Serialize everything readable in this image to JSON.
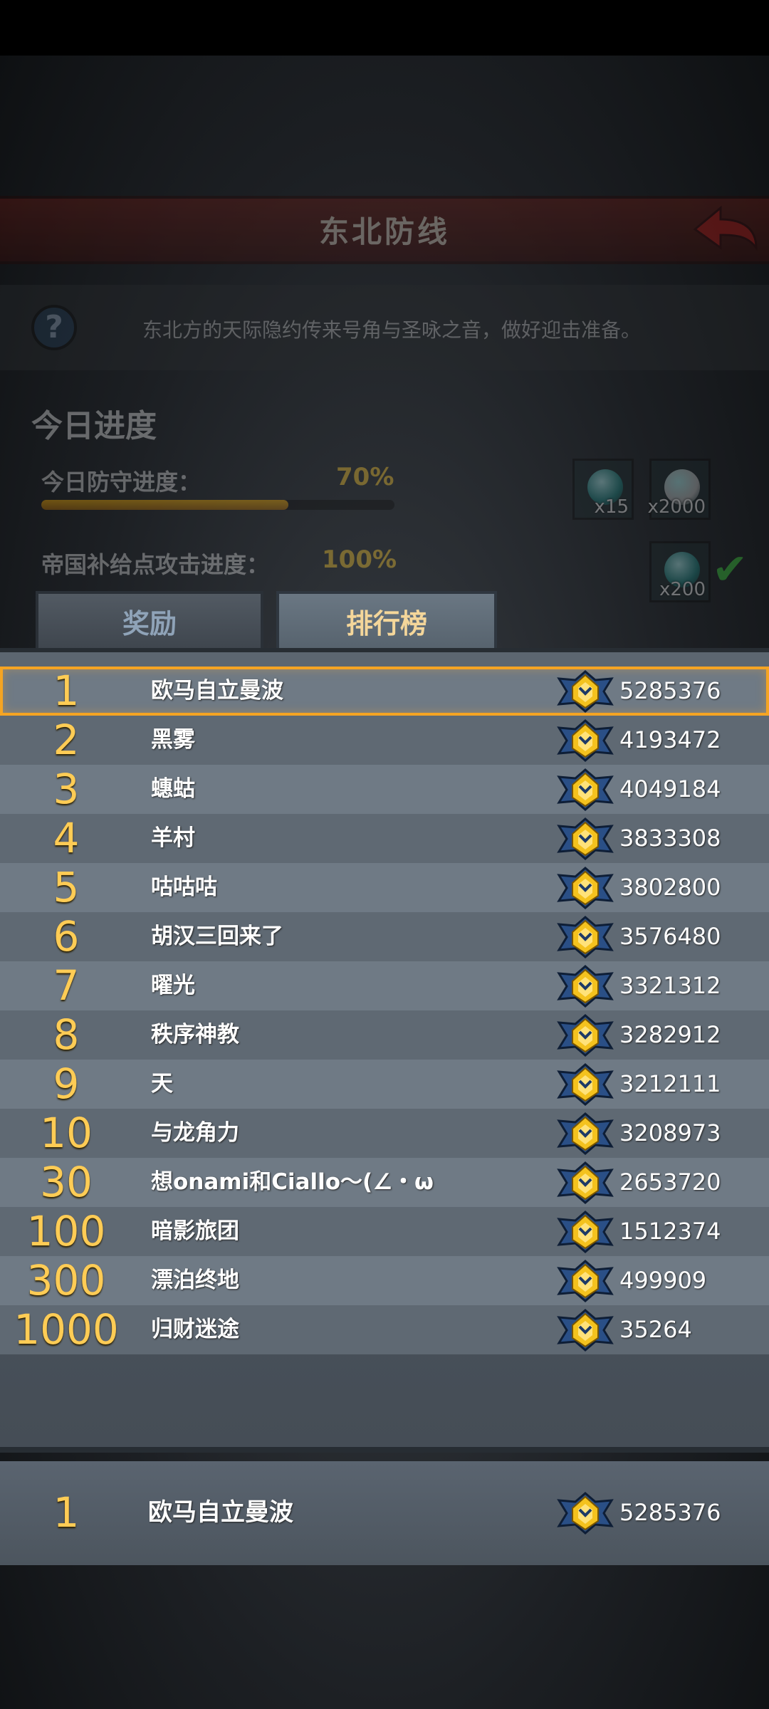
{
  "header": {
    "title": "东北防线"
  },
  "info": {
    "description": "东北方的天际隐约传来号角与圣咏之音，做好迎击准备。",
    "help_glyph": "?"
  },
  "progress": {
    "section_title": "今日进度",
    "items": [
      {
        "label": "今日防守进度：",
        "percent_text": "70%",
        "fraction": 0.7,
        "rewards": [
          {
            "count": "x15",
            "color": "#1e8a86"
          },
          {
            "count": "x2000",
            "color": "#c8c8c8"
          }
        ]
      },
      {
        "label": "帝国补给点攻击进度：",
        "percent_text": "100%",
        "fraction": 1.0,
        "rewards": [
          {
            "count": "x200",
            "color": "#1e8a86"
          }
        ],
        "completed": true
      }
    ]
  },
  "tabs": {
    "rewards": "奖励",
    "ranking": "排行榜",
    "active": "ranking"
  },
  "ranking": [
    {
      "rank": "1",
      "name": "欧马自立曼波",
      "score": "5285376"
    },
    {
      "rank": "2",
      "name": "黑雾",
      "score": "4193472"
    },
    {
      "rank": "3",
      "name": "蟪蛄",
      "score": "4049184"
    },
    {
      "rank": "4",
      "name": "羊村",
      "score": "3833308"
    },
    {
      "rank": "5",
      "name": "咕咕咕",
      "score": "3802800"
    },
    {
      "rank": "6",
      "name": "胡汉三回来了",
      "score": "3576480"
    },
    {
      "rank": "7",
      "name": "曜光",
      "score": "3321312"
    },
    {
      "rank": "8",
      "name": "秩序神教",
      "score": "3282912"
    },
    {
      "rank": "9",
      "name": "天",
      "score": "3212111"
    },
    {
      "rank": "10",
      "name": "与龙角力",
      "score": "3208973"
    },
    {
      "rank": "30",
      "name": "想onami和Ciallo～(∠・ω",
      "score": "2653720"
    },
    {
      "rank": "100",
      "name": "暗影旅团",
      "score": "1512374"
    },
    {
      "rank": "300",
      "name": "漂泊终地",
      "score": "499909"
    },
    {
      "rank": "1000",
      "name": "归财迷途",
      "score": "35264"
    }
  ],
  "my_rank": {
    "rank": "1",
    "name": "欧马自立曼波",
    "score": "5285376"
  },
  "colors": {
    "rank_gold": "#ffcc55",
    "highlight": "#f5a423",
    "banner_red": "#6b1a13"
  },
  "icons": {
    "back": "back-arrow-icon",
    "badge": "rank-badge-icon",
    "help": "help-icon",
    "check": "check-icon"
  }
}
